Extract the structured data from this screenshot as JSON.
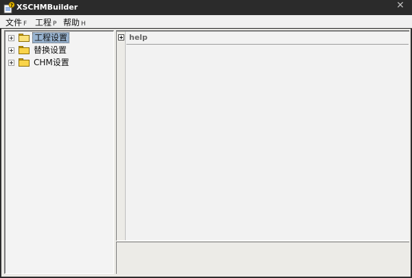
{
  "window": {
    "title": "XSCHMBuilder",
    "close_symbol": "✕"
  },
  "menu": [
    {
      "label": "文件",
      "accel": "F"
    },
    {
      "label": "工程",
      "accel": "P"
    },
    {
      "label": "帮助",
      "accel": "H"
    }
  ],
  "tree": [
    {
      "label": "工程设置",
      "selected": true,
      "icon": "folder-open-icon"
    },
    {
      "label": "替换设置",
      "selected": false,
      "icon": "folder-icon"
    },
    {
      "label": "CHM设置",
      "selected": false,
      "icon": "folder-icon"
    }
  ],
  "panel": {
    "title": "help"
  },
  "colors": {
    "titlebar": "#2b2b2b",
    "selection": "#99b4d1",
    "client": "#ecebe7"
  }
}
